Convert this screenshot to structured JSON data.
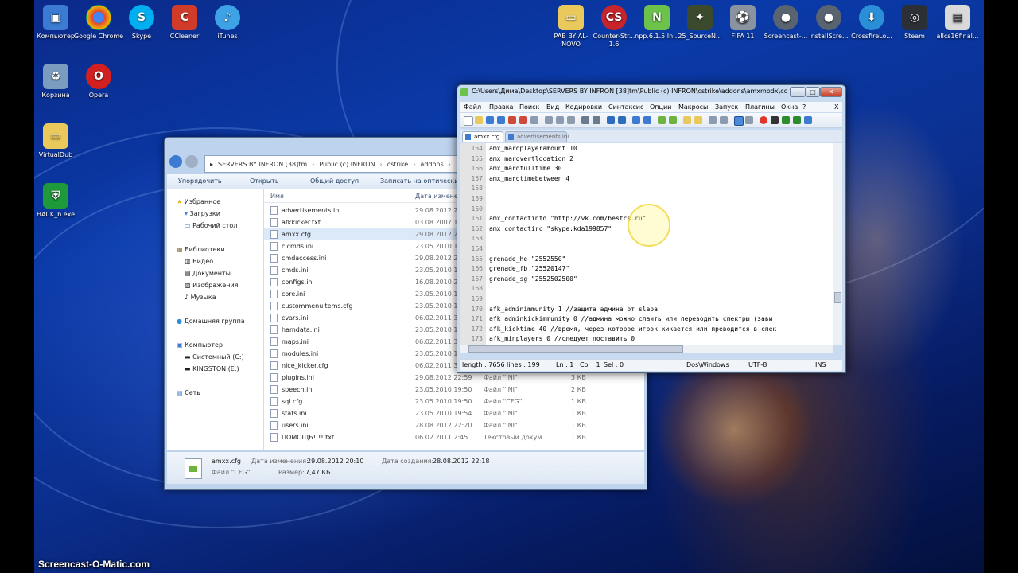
{
  "desktop": {
    "icons_left": [
      {
        "label": "Компьютер"
      },
      {
        "label": "Google Chrome"
      },
      {
        "label": "Skype"
      },
      {
        "label": "CCleaner"
      },
      {
        "label": "iTunes"
      },
      {
        "label": "Корзина"
      },
      {
        "label": "Opera"
      },
      {
        "label": "VirtualDub"
      },
      {
        "label": "HACK_b.exe"
      }
    ],
    "icons_right": [
      {
        "label": "PAB BY AL-NOVO"
      },
      {
        "label": "Counter-Str... 1.6"
      },
      {
        "label": "npp.6.1.5.In..."
      },
      {
        "label": "25_SourceN..."
      },
      {
        "label": "FIFA 11"
      },
      {
        "label": "Screencast-..."
      },
      {
        "label": "InstallScre..."
      },
      {
        "label": "CrossfireLo..."
      },
      {
        "label": "Steam"
      },
      {
        "label": "allcs16final..."
      }
    ],
    "watermark": "Screencast-O-Matic.com"
  },
  "explorer": {
    "breadcrumb": [
      "SERVERS BY INFRON [38]tm",
      "Public (c) INFRON",
      "cstrike",
      "addons",
      "..."
    ],
    "toolbar": {
      "organize": "Упорядочить",
      "open": "Открыть",
      "share": "Общий доступ",
      "burn": "Записать на оптический"
    },
    "nav": {
      "favorites": "Избранное",
      "downloads": "Загрузки",
      "desktop": "Рабочий стол",
      "libraries": "Библиотеки",
      "video": "Видео",
      "documents": "Документы",
      "pictures": "Изображения",
      "music": "Музыка",
      "homegroup": "Домашняя группа",
      "computer": "Компьютер",
      "drive_c": "Системный (C:)",
      "drive_e": "KINGSTON (E:)",
      "network": "Сеть"
    },
    "columns": {
      "name": "Имя",
      "date": "Дата изменен"
    },
    "files": [
      {
        "name": "advertisements.ini",
        "date": "29.08.2012 20:",
        "type": "",
        "size": ""
      },
      {
        "name": "afkkicker.txt",
        "date": "03.08.2007 14:",
        "type": "",
        "size": ""
      },
      {
        "name": "amxx.cfg",
        "date": "29.08.2012 20:",
        "type": "",
        "size": ""
      },
      {
        "name": "clcmds.ini",
        "date": "23.05.2010 19:",
        "type": "",
        "size": ""
      },
      {
        "name": "cmdaccess.ini",
        "date": "29.08.2012 20:",
        "type": "",
        "size": ""
      },
      {
        "name": "cmds.ini",
        "date": "23.05.2010 19:",
        "type": "",
        "size": ""
      },
      {
        "name": "configs.ini",
        "date": "16.08.2010 20:",
        "type": "",
        "size": ""
      },
      {
        "name": "core.ini",
        "date": "23.05.2010 19:",
        "type": "",
        "size": ""
      },
      {
        "name": "custommenuitems.cfg",
        "date": "23.05.2010 19:",
        "type": "",
        "size": ""
      },
      {
        "name": "cvars.ini",
        "date": "06.02.2011 3:",
        "type": "",
        "size": ""
      },
      {
        "name": "hamdata.ini",
        "date": "23.05.2010 19:",
        "type": "",
        "size": ""
      },
      {
        "name": "maps.ini",
        "date": "06.02.2011 3:",
        "type": "",
        "size": ""
      },
      {
        "name": "modules.ini",
        "date": "23.05.2010 19:",
        "type": "",
        "size": ""
      },
      {
        "name": "nice_kicker.cfg",
        "date": "06.02.2011 3:",
        "type": "",
        "size": ""
      },
      {
        "name": "plugins.ini",
        "date": "29.08.2012 22:59",
        "type": "Файл \"INI\"",
        "size": "3 КБ"
      },
      {
        "name": "speech.ini",
        "date": "23.05.2010 19:50",
        "type": "Файл \"INI\"",
        "size": "2 КБ"
      },
      {
        "name": "sql.cfg",
        "date": "23.05.2010 19:50",
        "type": "Файл \"CFG\"",
        "size": "1 КБ"
      },
      {
        "name": "stats.ini",
        "date": "23.05.2010 19:54",
        "type": "Файл \"INI\"",
        "size": "1 КБ"
      },
      {
        "name": "users.ini",
        "date": "28.08.2012 22:20",
        "type": "Файл \"INI\"",
        "size": "1 КБ"
      },
      {
        "name": "ПОМОЩЬ!!!!.txt",
        "date": "06.02.2011 2:45",
        "type": "Текстовый докум...",
        "size": "1 КБ"
      }
    ],
    "status": {
      "filename": "amxx.cfg",
      "filetype": "Файл \"CFG\"",
      "modified_label": "Дата изменения:",
      "modified": "29.08.2012 20:10",
      "created_label": "Дата создания:",
      "created": "28.08.2012 22:18",
      "size_label": "Размер:",
      "size": "7,47 КБ"
    }
  },
  "npp": {
    "title": "C:\\Users\\Дима\\Desktop\\SERVERS BY INFRON [38]tm\\Public (c) INFRON\\cstrike\\addons\\amxmodx\\con...",
    "menu": [
      "Файл",
      "Правка",
      "Поиск",
      "Вид",
      "Кодировки",
      "Синтаксис",
      "Опции",
      "Макросы",
      "Запуск",
      "Плагины",
      "Окна",
      "?",
      "X"
    ],
    "tabs": [
      {
        "label": "amxx.cfg"
      },
      {
        "label": "advertisements.ini"
      }
    ],
    "lines": [
      {
        "n": "154",
        "t": "amx_marqplayeramount 10"
      },
      {
        "n": "155",
        "t": "amx_marqvertlocation 2"
      },
      {
        "n": "156",
        "t": "amx_marqfulltime 30"
      },
      {
        "n": "157",
        "t": "amx_marqtimebetween 4"
      },
      {
        "n": "158",
        "t": ""
      },
      {
        "n": "159",
        "t": ""
      },
      {
        "n": "160",
        "t": ""
      },
      {
        "n": "161",
        "t": "amx_contactinfo \"http://vk.com/bestcs.ru\""
      },
      {
        "n": "162",
        "t": "amx_contactirc \"skype:kda199857\""
      },
      {
        "n": "163",
        "t": ""
      },
      {
        "n": "164",
        "t": ""
      },
      {
        "n": "165",
        "t": "grenade_he \"2552550\""
      },
      {
        "n": "166",
        "t": "grenade_fb \"25520147\""
      },
      {
        "n": "167",
        "t": "grenade_sg \"2552502500\""
      },
      {
        "n": "168",
        "t": ""
      },
      {
        "n": "169",
        "t": ""
      },
      {
        "n": "170",
        "t": "afk_adminimmunity 1 //защита админа от slapa"
      },
      {
        "n": "171",
        "t": "afk_adminkickimmunity 0 //админа можно слаить или переводить спектры (зави"
      },
      {
        "n": "172",
        "t": "afk_kicktime 40 //время, через которое игрок кикается или преводится в спек"
      },
      {
        "n": "173",
        "t": "afk_minplayers 0 //следует поставить 0"
      }
    ],
    "status": {
      "length": "length : 7656",
      "lines": "lines : 199",
      "ln": "Ln : 1",
      "col": "Col : 1",
      "sel": "Sel : 0",
      "eol": "Dos\\Windows",
      "enc": "UTF-8",
      "mode": "INS"
    }
  }
}
